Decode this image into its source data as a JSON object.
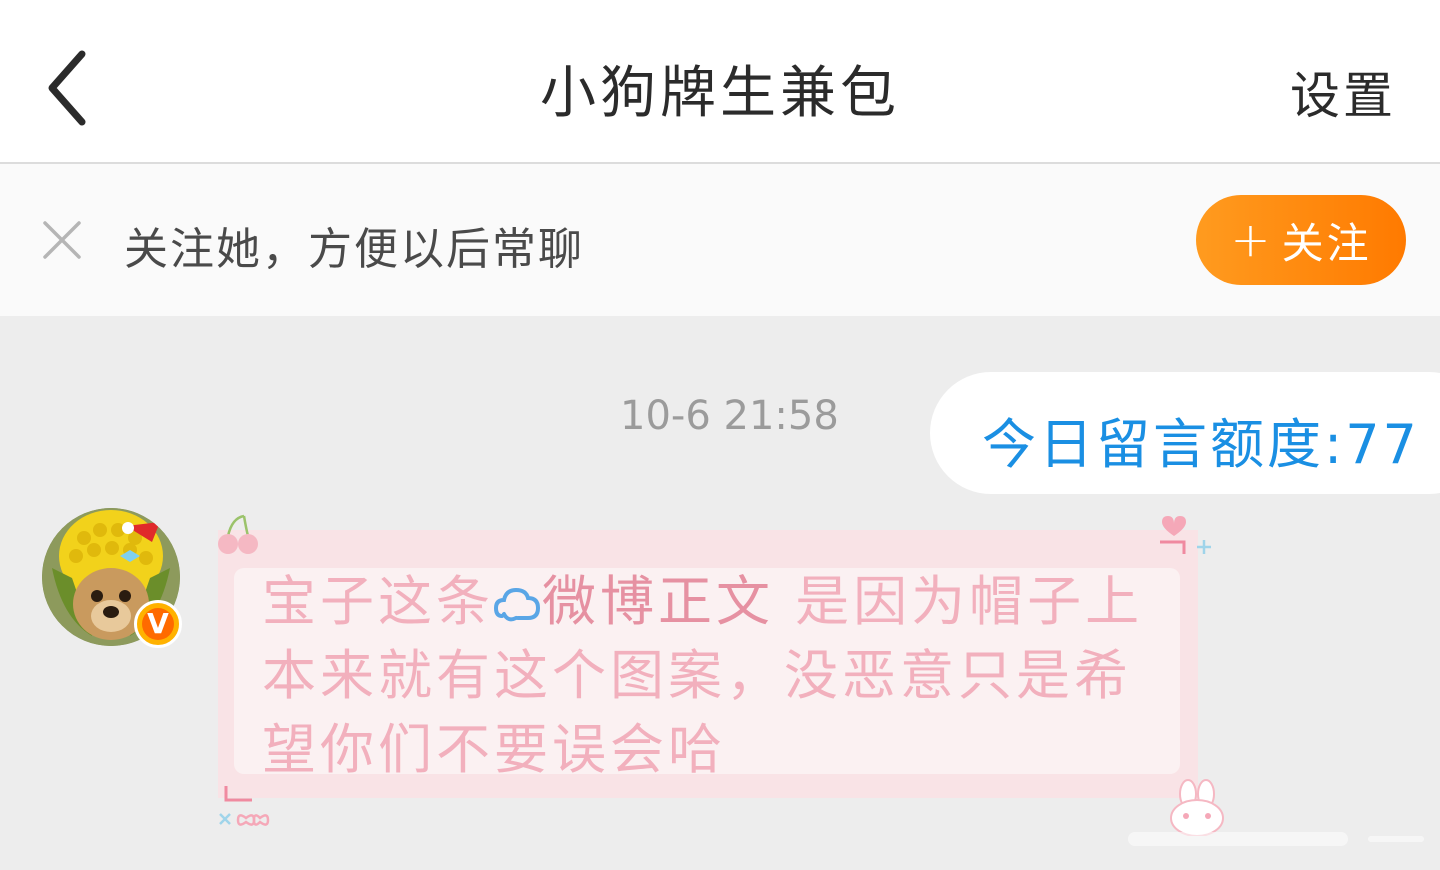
{
  "header": {
    "title": "小狗牌生兼包",
    "settings_label": "设置"
  },
  "follow_bar": {
    "prompt": "关注她，方便以后常聊",
    "follow_label": "关注"
  },
  "chat": {
    "timestamp": "10-6 21:58",
    "my_message": "今日留言额度:77",
    "incoming": {
      "part1": "宝子这条",
      "link_text": "微博正文",
      "part2": " 是因为帽子上本来就有这个图案，没恶意只是希望你们不要误会哈"
    }
  },
  "colors": {
    "accent_orange": "#ff8a10",
    "link_blue": "#1a8fe3",
    "pink_text": "#f2b0bd"
  },
  "icons": [
    "back-arrow-icon",
    "close-icon",
    "plus-icon",
    "weibo-link-icon",
    "verified-v-badge-icon"
  ]
}
